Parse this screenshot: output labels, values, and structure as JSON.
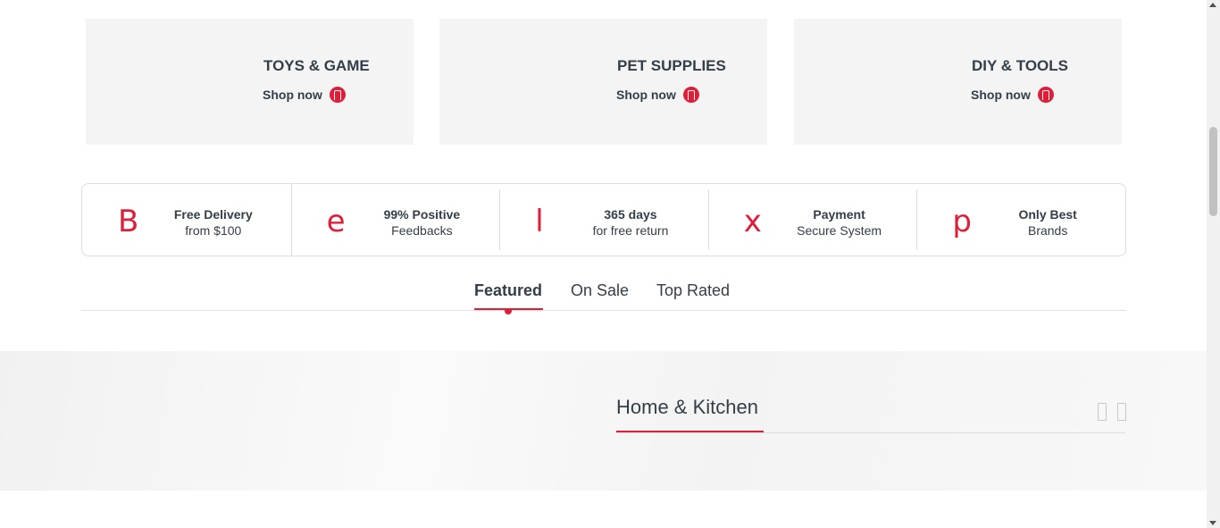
{
  "categories": [
    {
      "title": "TOYS & GAME",
      "link_label": "Shop now",
      "icon": "arrow-circle-icon"
    },
    {
      "title": "PET SUPPLIES",
      "link_label": "Shop now",
      "icon": "arrow-circle-icon"
    },
    {
      "title": "DIY & TOOLS",
      "link_label": "Shop now",
      "icon": "arrow-circle-icon"
    }
  ],
  "features": [
    {
      "glyph": "B",
      "title": "Free Delivery",
      "subtitle": "from $100",
      "icon": "delivery-icon"
    },
    {
      "glyph": "e",
      "title": "99% Positive",
      "subtitle": "Feedbacks",
      "icon": "feedback-icon"
    },
    {
      "glyph": "l",
      "title": "365 days",
      "subtitle": "for free return",
      "icon": "return-icon"
    },
    {
      "glyph": "x",
      "title": "Payment",
      "subtitle": "Secure System",
      "icon": "payment-icon"
    },
    {
      "glyph": "p",
      "title": "Only Best",
      "subtitle": "Brands",
      "icon": "brand-icon"
    }
  ],
  "tabs": [
    {
      "label": "Featured",
      "active": true
    },
    {
      "label": "On Sale",
      "active": false
    },
    {
      "label": "Top Rated",
      "active": false
    }
  ],
  "band": {
    "title": "Home & Kitchen",
    "prev_icon": "chevron-left-icon",
    "next_icon": "chevron-right-icon"
  },
  "colors": {
    "accent": "#df1f3a",
    "text": "#333e48",
    "card_bg": "#f4f4f4",
    "border": "#dddddd"
  }
}
